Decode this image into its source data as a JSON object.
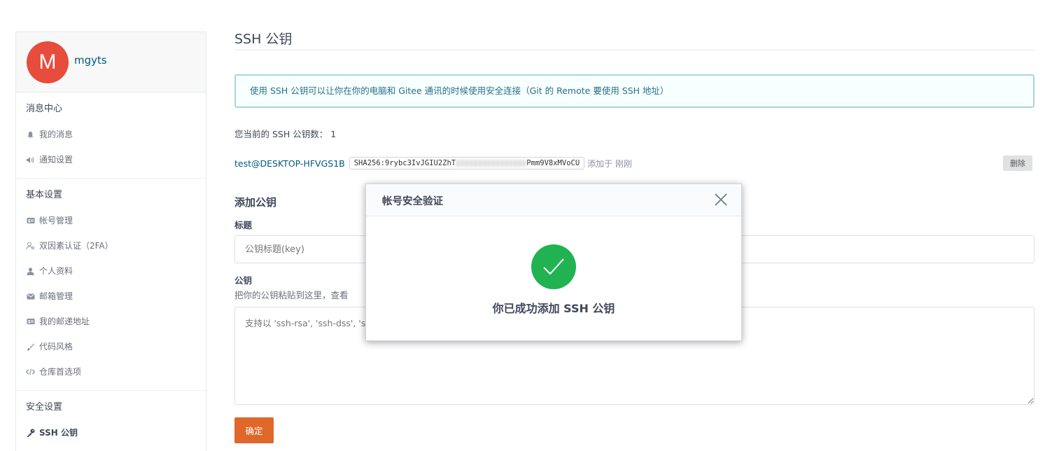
{
  "user": {
    "avatar_letter": "M",
    "name": "mgyts",
    "avatar_color": "#e74c3c"
  },
  "sidebar": {
    "sections": [
      {
        "title": "消息中心",
        "items": [
          {
            "label": "我的消息",
            "icon": "bell-icon"
          },
          {
            "label": "通知设置",
            "icon": "speaker-icon"
          }
        ]
      },
      {
        "title": "基本设置",
        "items": [
          {
            "label": "帐号管理",
            "icon": "id-card-icon"
          },
          {
            "label": "双因素认证（2FA）",
            "icon": "user-key-icon"
          },
          {
            "label": "个人资料",
            "icon": "user-icon"
          },
          {
            "label": "邮箱管理",
            "icon": "envelope-icon"
          },
          {
            "label": "我的邮递地址",
            "icon": "address-card-icon"
          },
          {
            "label": "代码风格",
            "icon": "brush-icon"
          },
          {
            "label": "仓库首选项",
            "icon": "code-icon"
          }
        ]
      },
      {
        "title": "安全设置",
        "items": [
          {
            "label": "SSH 公钥",
            "icon": "key-icon",
            "active": true
          }
        ]
      }
    ]
  },
  "main": {
    "title": "SSH 公钥",
    "info": "使用 SSH 公钥可以让你在你的电脑和 Gitee 通讯的时候使用安全连接（Git 的 Remote 要使用 SSH 地址）",
    "count_label": "您当前的 SSH 公钥数：",
    "count_value": "1",
    "key": {
      "name": "test@DESKTOP-HFVGS1B",
      "fingerprint_start": "SHA256:9rybc3IvJGIU2ZhT",
      "fingerprint_hidden": "xxxxxxxxxxxxxxxx",
      "fingerprint_end": "Pmm9V8xMVoCU",
      "added": "添加于 刚刚",
      "delete_label": "删除"
    },
    "add_title": "添加公钥",
    "title_label": "标题",
    "title_placeholder": "公钥标题(key)",
    "pubkey_label": "公钥",
    "pubkey_hint": "把你的公钥粘贴到这里，查看",
    "pubkey_placeholder": "支持以 'ssh-rsa', 'ssh-dss', 's",
    "submit_label": "确定"
  },
  "modal": {
    "title": "帐号安全验证",
    "message": "你已成功添加 SSH 公钥",
    "success_color": "#21b351"
  }
}
